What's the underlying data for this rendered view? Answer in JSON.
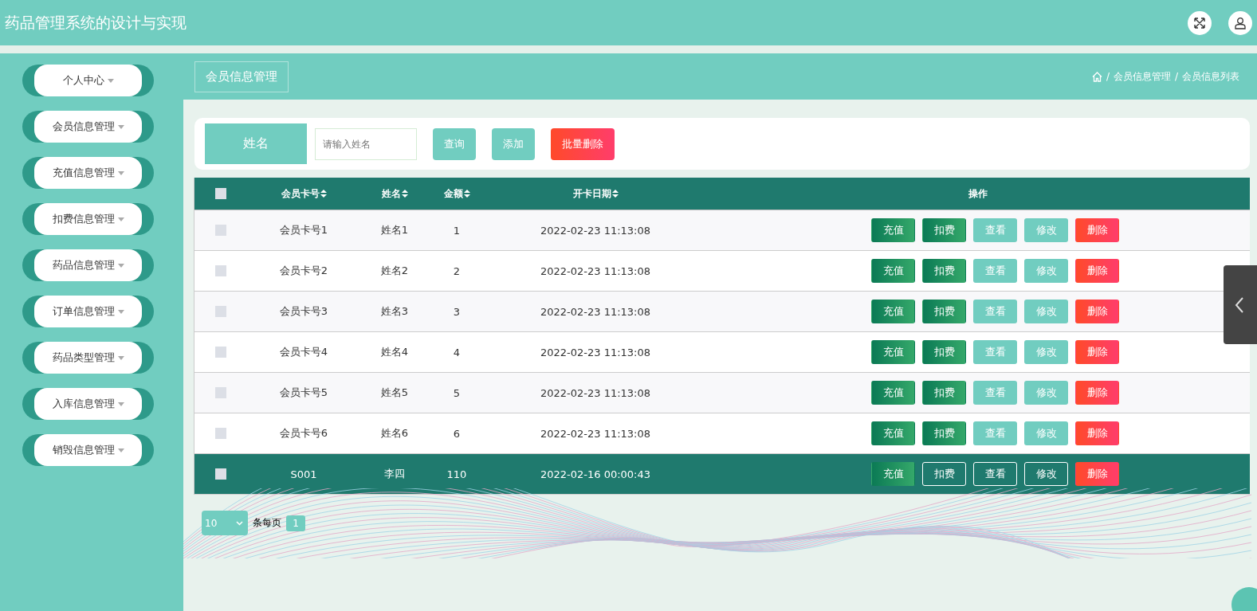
{
  "header": {
    "title": "药品管理系统的设计与实现"
  },
  "sidebar": {
    "items": [
      {
        "label": "个人中心"
      },
      {
        "label": "会员信息管理"
      },
      {
        "label": "充值信息管理"
      },
      {
        "label": "扣费信息管理"
      },
      {
        "label": "药品信息管理"
      },
      {
        "label": "订单信息管理"
      },
      {
        "label": "药品类型管理"
      },
      {
        "label": "入库信息管理"
      },
      {
        "label": "销毁信息管理"
      }
    ]
  },
  "page_title": "会员信息管理",
  "breadcrumb": {
    "separator": "/",
    "items": [
      "会员信息管理",
      "会员信息列表"
    ]
  },
  "search": {
    "label": "姓名",
    "placeholder": "请输入姓名",
    "buttons": [
      {
        "label": "查询",
        "kind": "primary"
      },
      {
        "label": "添加",
        "kind": "primary"
      },
      {
        "label": "批量删除",
        "kind": "danger"
      }
    ]
  },
  "table": {
    "header_checked": false,
    "columns": [
      {
        "label": "会员卡号",
        "sortable": true
      },
      {
        "label": "姓名",
        "sortable": true
      },
      {
        "label": "金额",
        "sortable": true
      },
      {
        "label": "开卡日期",
        "sortable": true
      },
      {
        "label": "操作",
        "sortable": false
      }
    ],
    "rows": [
      {
        "checked": false,
        "highlighted": false,
        "cells": [
          "会员卡号1",
          "姓名1",
          "1",
          "2022-02-23 11:13:08"
        ],
        "actions": [
          {
            "label": "充值",
            "kind": "dark"
          },
          {
            "label": "扣费",
            "kind": "dark"
          },
          {
            "label": "查看",
            "kind": "light"
          },
          {
            "label": "修改",
            "kind": "light"
          },
          {
            "label": "删除",
            "kind": "danger"
          }
        ]
      },
      {
        "checked": false,
        "highlighted": false,
        "cells": [
          "会员卡号2",
          "姓名2",
          "2",
          "2022-02-23 11:13:08"
        ],
        "actions": [
          {
            "label": "充值",
            "kind": "dark"
          },
          {
            "label": "扣费",
            "kind": "dark"
          },
          {
            "label": "查看",
            "kind": "light"
          },
          {
            "label": "修改",
            "kind": "light"
          },
          {
            "label": "删除",
            "kind": "danger"
          }
        ]
      },
      {
        "checked": false,
        "highlighted": false,
        "cells": [
          "会员卡号3",
          "姓名3",
          "3",
          "2022-02-23 11:13:08"
        ],
        "actions": [
          {
            "label": "充值",
            "kind": "dark"
          },
          {
            "label": "扣费",
            "kind": "dark"
          },
          {
            "label": "查看",
            "kind": "light"
          },
          {
            "label": "修改",
            "kind": "light"
          },
          {
            "label": "删除",
            "kind": "danger"
          }
        ]
      },
      {
        "checked": false,
        "highlighted": false,
        "cells": [
          "会员卡号4",
          "姓名4",
          "4",
          "2022-02-23 11:13:08"
        ],
        "actions": [
          {
            "label": "充值",
            "kind": "dark"
          },
          {
            "label": "扣费",
            "kind": "dark"
          },
          {
            "label": "查看",
            "kind": "light"
          },
          {
            "label": "修改",
            "kind": "light"
          },
          {
            "label": "删除",
            "kind": "danger"
          }
        ]
      },
      {
        "checked": false,
        "highlighted": false,
        "cells": [
          "会员卡号5",
          "姓名5",
          "5",
          "2022-02-23 11:13:08"
        ],
        "actions": [
          {
            "label": "充值",
            "kind": "dark"
          },
          {
            "label": "扣费",
            "kind": "dark"
          },
          {
            "label": "查看",
            "kind": "light"
          },
          {
            "label": "修改",
            "kind": "light"
          },
          {
            "label": "删除",
            "kind": "danger"
          }
        ]
      },
      {
        "checked": false,
        "highlighted": false,
        "cells": [
          "会员卡号6",
          "姓名6",
          "6",
          "2022-02-23 11:13:08"
        ],
        "actions": [
          {
            "label": "充值",
            "kind": "dark"
          },
          {
            "label": "扣费",
            "kind": "dark"
          },
          {
            "label": "查看",
            "kind": "light"
          },
          {
            "label": "修改",
            "kind": "light"
          },
          {
            "label": "删除",
            "kind": "danger"
          }
        ]
      },
      {
        "checked": false,
        "highlighted": true,
        "cells": [
          "S001",
          "李四",
          "110",
          "2022-02-16 00:00:43"
        ],
        "actions": [
          {
            "label": "充值",
            "kind": "dark"
          },
          {
            "label": "扣费",
            "kind": "outline"
          },
          {
            "label": "查看",
            "kind": "outline"
          },
          {
            "label": "修改",
            "kind": "outline"
          },
          {
            "label": "删除",
            "kind": "danger"
          }
        ]
      }
    ]
  },
  "pagination": {
    "page_size": "10",
    "page_size_label": "条每页",
    "pages": [
      {
        "label": "1",
        "selected": true
      }
    ]
  }
}
